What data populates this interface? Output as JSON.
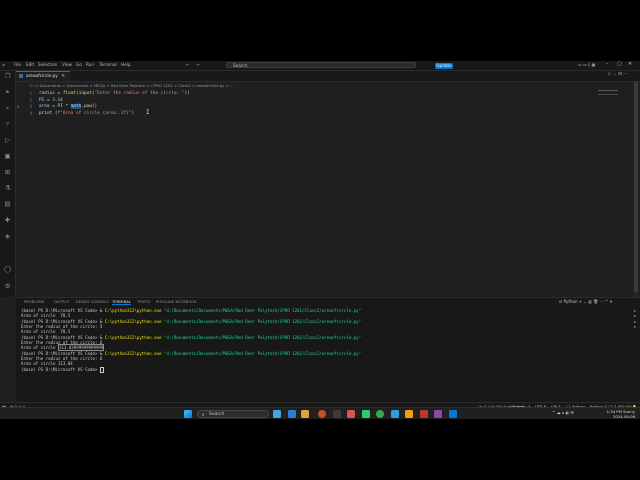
{
  "menu": [
    "File",
    "Edit",
    "Selection",
    "View",
    "Go",
    "Run",
    "Terminal",
    "Help"
  ],
  "search": "Search",
  "update_button": "Update",
  "tab": {
    "label": "areaofcircle.py"
  },
  "breadcrumb": "C: > Documents > Documents > MEGA > Red Deer Polytech > CPRO 1201 > Class2 > areaofcircle.py > ...",
  "editor": {
    "line_numbers": [
      "1",
      "2",
      "3",
      "4"
    ],
    "lines": [
      {
        "var": "radius",
        "op": " = ",
        "fn": "float",
        "p1": "(",
        "fn2": "input",
        "p2": "(",
        "str": "\"Enter the radius of the circle: \"",
        "end": "))"
      },
      {
        "var": "PI",
        "op": " = ",
        "num": "3.14"
      },
      {
        "var": "area",
        "op": " = ",
        "var2": "PI",
        "op2": " * ",
        "hl": "math",
        "rest": ".pow()"
      },
      {
        "fn": "print",
        "p1": " (",
        "str": "f\"Area of circle {area:.2f}\"",
        "end": ")"
      }
    ]
  },
  "panel": {
    "tabs": [
      "PROBLEMS",
      "OUTPUT",
      "DEBUG CONSOLE",
      "TERMINAL",
      "PORTS",
      "PHYSLIDE NOTEBOOK"
    ],
    "active_tab": "TERMINAL",
    "shell_label": "Python",
    "terminal": [
      {
        "prompt": "(base) PS D:\\Microsoft VS Code> & ",
        "cmd": "C:\\python312\\python.exe",
        "arg": " \"d:/Documents/Documents/MEGA/Red Deer Polytech/CPRO 1201/Class2/areaofcircle.py\""
      },
      {
        "text": "Area of circle  78.5"
      },
      {
        "prompt": "(base) PS D:\\Microsoft VS Code> & ",
        "cmd": "C:\\python312\\python.exe",
        "arg": " \"d:/Documents/Documents/MEGA/Red Deer Polytech/CPRO 1201/Class2/areaofcircle.py\""
      },
      {
        "text": "Enter the radius of the circle: 5"
      },
      {
        "text": "Area of circle  78.5"
      },
      {
        "prompt": "(base) PS D:\\Microsoft VS Code> & ",
        "cmd": "C:\\python312\\python.exe",
        "arg": " \"d:/Documents/Documents/MEGA/Red Deer Polytech/CPRO 1201/Class2/areaofcircle.py\""
      },
      {
        "text": "Enter the radius of the circle: 6"
      },
      {
        "text": "Area of circle ",
        "boxed": "113.03999999999999"
      },
      {
        "prompt": "(base) PS D:\\Microsoft VS Code> & ",
        "cmd": "C:\\python312\\python.exe",
        "arg": " \"d:/Documents/Documents/MEGA/Red Deer Polytech/CPRO 1201/Class2/areaofcircle.py\""
      },
      {
        "text": "Enter the radius of the circle: 6"
      },
      {
        "text": "Area of circle 113.04"
      },
      {
        "prompt": "(base) PS D:\\Microsoft VS Code> "
      }
    ]
  },
  "status": {
    "left": "⊗ 0  ⚠ 0",
    "cursor": "Ln 3, Col 19 (4 selected)",
    "spaces": "Spaces: 4",
    "encoding": "UTF-8",
    "eol": "CRLF",
    "language": "{ } Python",
    "interpreter": "Python 3.12.3 (64-bit)"
  },
  "taskbar": {
    "search": "Search",
    "time": "1:34 PM",
    "weather": "Sunny",
    "date": "2024-09-06"
  },
  "colors": {
    "accent": "#0078d4",
    "editor_bg": "#1f1f1f"
  }
}
